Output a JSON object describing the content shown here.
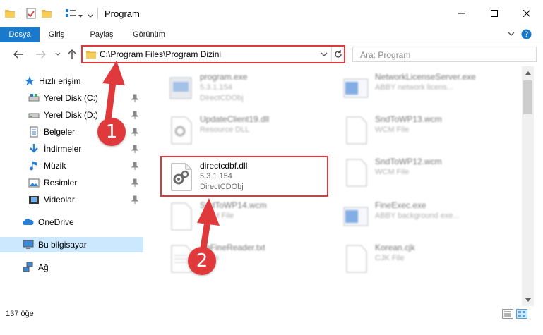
{
  "window": {
    "title": "Program",
    "minimize_icon": "minimize-icon",
    "maximize_icon": "maximize-icon",
    "close_icon": "close-icon"
  },
  "ribbon": {
    "tabs": [
      {
        "label": "Dosya"
      },
      {
        "label": "Giriş"
      },
      {
        "label": "Paylaş"
      },
      {
        "label": "Görünüm"
      }
    ]
  },
  "address": {
    "path": "C:\\Program Files\\Program Dizini"
  },
  "search": {
    "placeholder": "Ara: Program"
  },
  "sidebar": {
    "items": [
      {
        "label": "Hızlı erişim"
      },
      {
        "label": "Yerel Disk (C:)"
      },
      {
        "label": "Yerel Disk (D:)"
      },
      {
        "label": "Belgeler"
      },
      {
        "label": "İndirmeler"
      },
      {
        "label": "Müzik"
      },
      {
        "label": "Resimler"
      },
      {
        "label": "Videolar"
      },
      {
        "label": "OneDrive"
      },
      {
        "label": "Bu bilgisayar"
      },
      {
        "label": "Ağ"
      }
    ]
  },
  "files": {
    "items": [
      {
        "name": "program.exe",
        "line2": "5.3.1.154",
        "line3": "DirectCDObj"
      },
      {
        "name": "NetworkLicenseServer.exe",
        "line2": "ABBY network licens...",
        "line3": ""
      },
      {
        "name": "UpdateClient19.dll",
        "line2": "Resource DLL",
        "line3": ""
      },
      {
        "name": "SndToWP13.wcm",
        "line2": "WCM File",
        "line3": ""
      },
      {
        "name": "directcdbf.dll",
        "line2": "5.3.1.154",
        "line3": "DirectCDObj"
      },
      {
        "name": "SndToWP12.wcm",
        "line2": "WCM File",
        "line3": ""
      },
      {
        "name": "SndToWP14.wcm",
        "line2": "WCM File",
        "line3": ""
      },
      {
        "name": "FineExec.exe",
        "line2": "ABBY background exe...",
        "line3": ""
      },
      {
        "name": "AbFineReader.txt",
        "line2": "Metin",
        "line3": ""
      },
      {
        "name": "Korean.cjk",
        "line2": "CJK File",
        "line3": ""
      }
    ]
  },
  "status": {
    "count": "137 öğe"
  },
  "annotations": {
    "step1": "1",
    "step2": "2",
    "color": "#e0393b"
  },
  "colors": {
    "accent": "#1979ca",
    "selection": "#cce8ff",
    "highlight": "#e0393b"
  }
}
